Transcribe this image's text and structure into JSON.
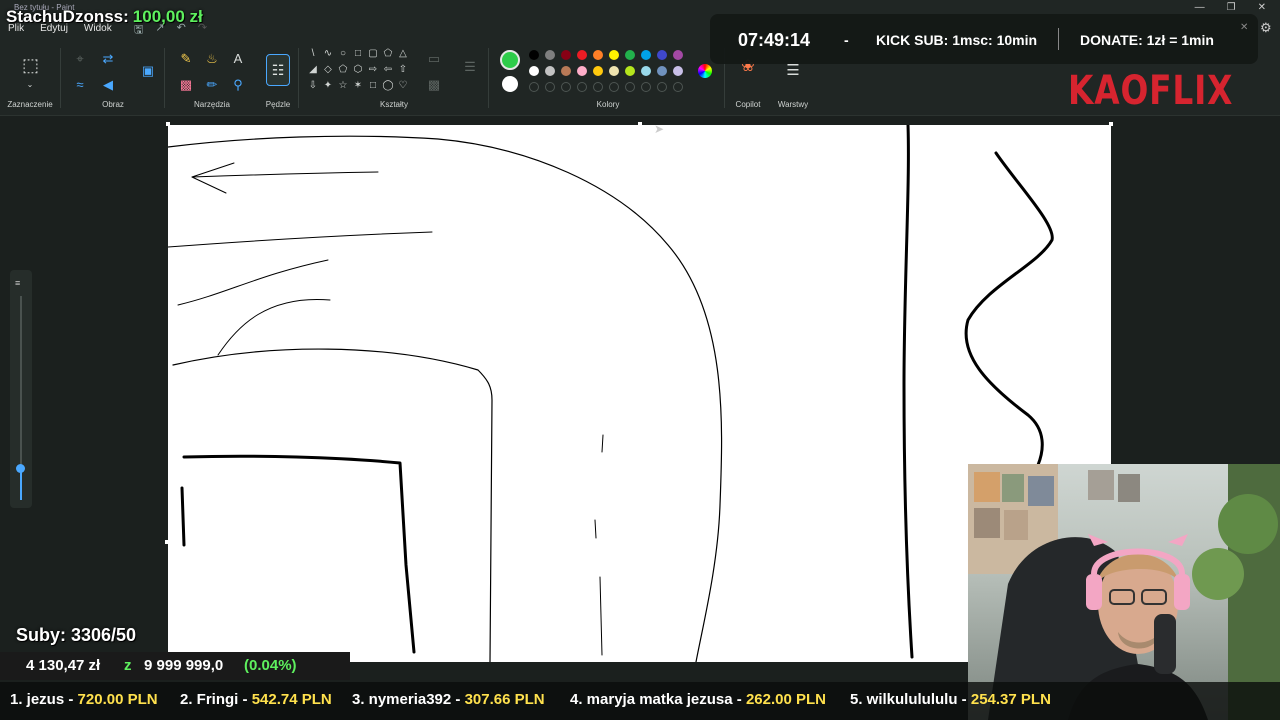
{
  "app": {
    "window_title": "Bez tytułu - Paint"
  },
  "streamer": {
    "name": "StachuDzonss:",
    "balance": "100,00 zł"
  },
  "menu": [
    "Plik",
    "Edytuj",
    "Widok"
  ],
  "ribbon": {
    "groups": {
      "selection": "Zaznaczenie",
      "image": "Obraz",
      "tools": "Narzędzia",
      "brushes": "Pędzle",
      "shapes": "Kształty",
      "colors": "Kolory",
      "copilot": "Copilot",
      "layers": "Warstwy"
    },
    "primary_color": "#2ecc4a",
    "secondary_color": "#ffffff",
    "palette_row1": [
      "#000000",
      "#7f7f7f",
      "#880015",
      "#ed1c24",
      "#ff7f27",
      "#fff200",
      "#22b14c",
      "#00a2e8",
      "#3f48cc",
      "#a349a4"
    ],
    "palette_row2": [
      "#ffffff",
      "#c3c3c3",
      "#b97a57",
      "#ffaec9",
      "#ffc90e",
      "#efe4b0",
      "#b5e61d",
      "#99d9ea",
      "#7092be",
      "#c8bfe7"
    ]
  },
  "overlay": {
    "clock": "07:49:14",
    "separator": "-",
    "kick_sub": "KICK SUB: 1msc: 10min",
    "donate": "DONATE: 1zł = 1min",
    "brand": "KAOFLIX"
  },
  "subs": {
    "label": "Suby: 3306/50"
  },
  "goal": {
    "current": "4 130,47 zł",
    "z": "z",
    "target": "9 999 999,0",
    "percent": "(0.04%)"
  },
  "ticker": [
    {
      "rank": "1. jezus",
      "amount": "720.00 PLN"
    },
    {
      "rank": "2. Fringi",
      "amount": "542.74 PLN"
    },
    {
      "rank": "3. nymeria392",
      "amount": "307.66 PLN"
    },
    {
      "rank": "4. maryja matka jezusa",
      "amount": "262.00 PLN"
    },
    {
      "rank": "5. wilkululululu",
      "amount": "254.37 PLN"
    }
  ]
}
